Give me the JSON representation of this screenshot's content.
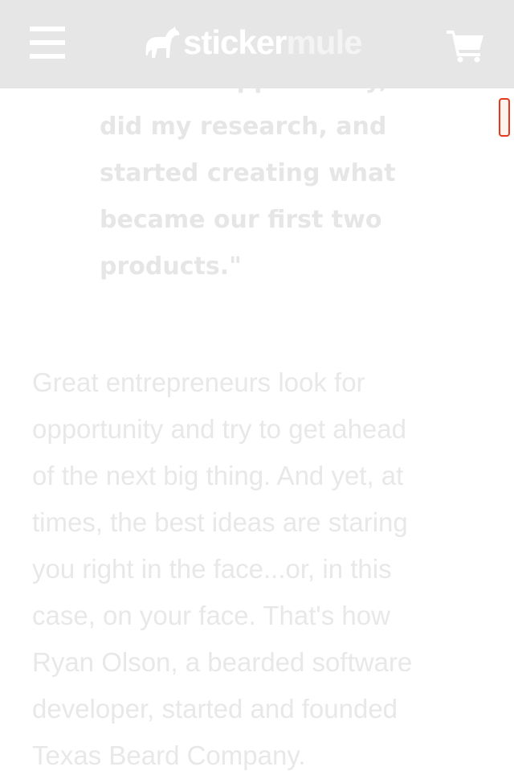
{
  "header": {
    "logo": {
      "word_primary": "sticker",
      "word_secondary": "mule",
      "icon": "mule-icon"
    },
    "menu_icon": "hamburger-menu-icon",
    "cart_icon": "shopping-cart-icon",
    "colors": {
      "background": "#e6e6e6",
      "icon": "#ffffff"
    }
  },
  "quote": {
    "icon": "quote-mark-icon",
    "lines": [
      "I saw an opportunity,",
      "did my research, and",
      "started creating what",
      "became our first two",
      "products.\""
    ]
  },
  "article": {
    "lines": [
      "Great entrepreneurs look for",
      "opportunity and try to get ahead",
      "of the next big thing. And yet, at",
      "times, the best ideas are staring",
      "you right in the face...or, in this",
      "case, on your face. That's how",
      "Ryan Olson, a bearded software",
      "developer, started and founded",
      "Texas Beard Company."
    ]
  },
  "colors": {
    "text": "#e8e8e8",
    "scroll_indicator_border": "#e23a1a"
  }
}
